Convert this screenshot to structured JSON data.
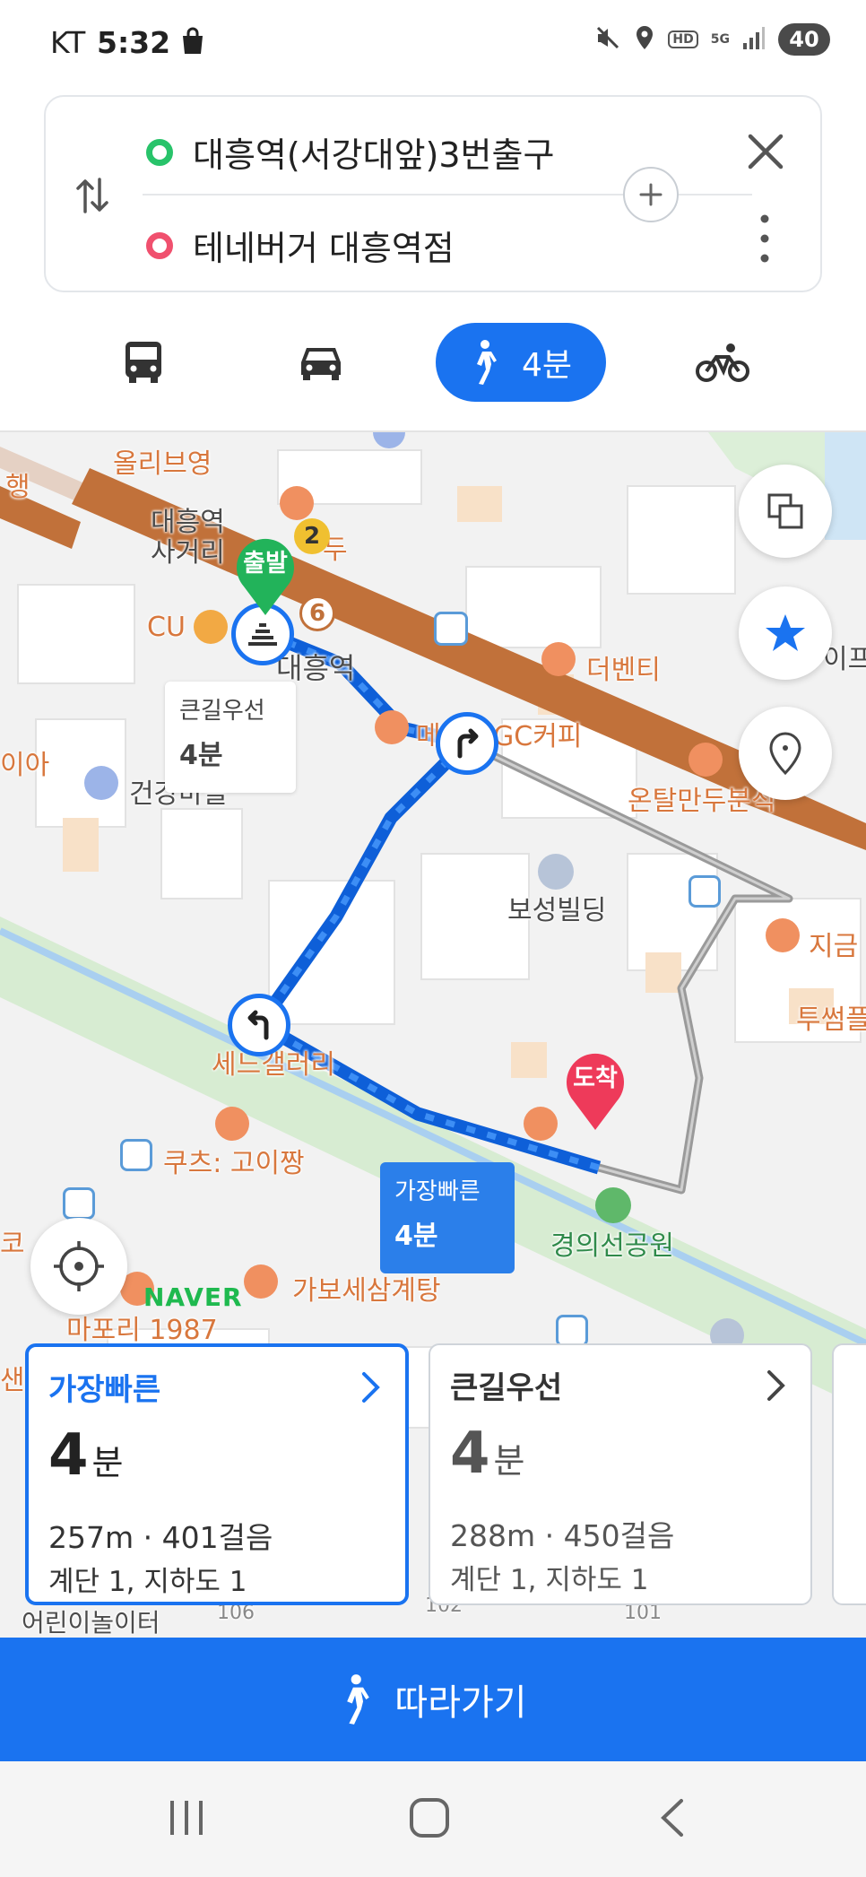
{
  "status_bar": {
    "carrier": "KT",
    "time": "5:32",
    "network": "5G",
    "hd": "HD",
    "battery": "40"
  },
  "route": {
    "origin": "대흥역(서강대앞)3번출구",
    "destination": "테네버거 대흥역점",
    "origin_color": "#28c36a",
    "destination_color": "#f0506e"
  },
  "modes": {
    "active": "walk",
    "walk_label": "4분",
    "accent": "#1a73f0"
  },
  "map": {
    "pois": {
      "oliveyoung": "올리브영",
      "heng": "행",
      "daeheung_sageori": "대흥역\n사거리",
      "station_name": "대흥역",
      "cu": "CU",
      "exit_6": "6",
      "exit_2": "2",
      "du": "두",
      "the_venti": "더벤티",
      "ipa": "이프",
      "ia": "이아",
      "mega": "메",
      "gc_coffee": "GC커피",
      "ontal": "온탈만두분식",
      "geongang_maeul": "건강마을",
      "boseong_building": "보성빌딩",
      "jigeum": "지금",
      "tusseom": "투썸플",
      "seine": "세느갤러리",
      "kuch": "쿠츠: 고이짱",
      "gyeongui_park": "경의선공원",
      "gabo": "가보세삼계탕",
      "mapori": "마포리 1987",
      "ko": "코",
      "sae": "샌",
      "playground": "어린이놀이터",
      "bld_106": "106",
      "bld_102": "102",
      "bld_101": "101"
    },
    "start_pin": "출발",
    "end_pin": "도착",
    "bubble_main": {
      "title": "큰길우선",
      "value": "4분"
    },
    "bubble_fast": {
      "title": "가장빠른",
      "value": "4분"
    },
    "naver": "NAVER"
  },
  "cards": [
    {
      "title": "가장빠른",
      "duration_num": "4",
      "duration_unit": "분",
      "detail1": "257m · 401걸음",
      "detail2": "계단 1, 지하도 1"
    },
    {
      "title": "큰길우선",
      "duration_num": "4",
      "duration_unit": "분",
      "detail1": "288m · 450걸음",
      "detail2": "계단 1, 지하도 1"
    }
  ],
  "follow_button": "따라가기"
}
